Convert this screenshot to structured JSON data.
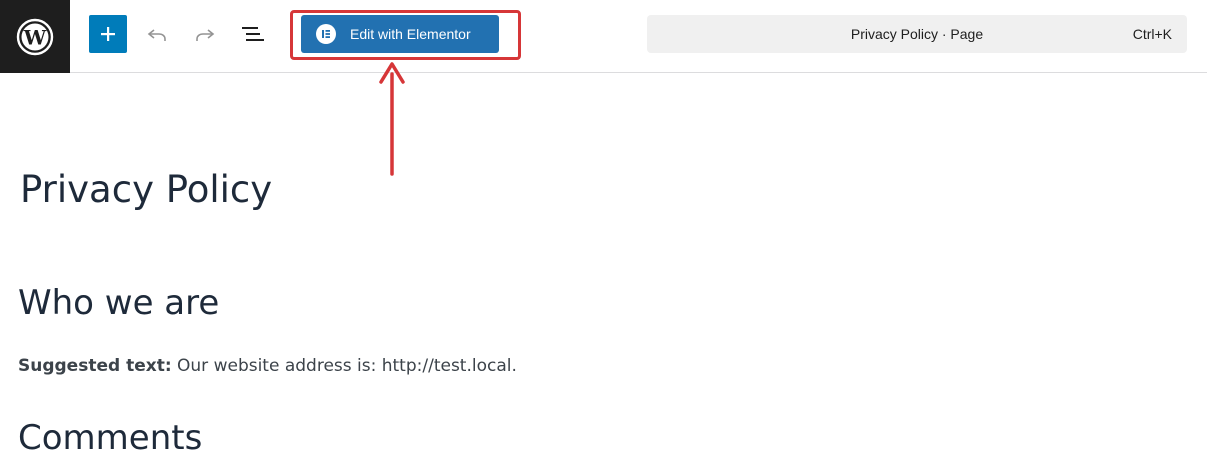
{
  "toolbar": {
    "logo_icon": "wordpress-logo-icon",
    "add_icon": "plus-icon",
    "undo_icon": "undo-icon",
    "redo_icon": "redo-icon",
    "outline_icon": "list-view-icon",
    "elementor_label": "Edit with Elementor",
    "elementor_icon": "elementor-logo-icon",
    "document_title": "Privacy Policy · Page",
    "shortcut": "Ctrl+K",
    "accent_color": "#007cba",
    "highlight_color": "#d63638"
  },
  "content": {
    "title": "Privacy Policy",
    "heading_who": "Who we are",
    "suggested_label": "Suggested text:",
    "suggested_body": " Our website address is: http://test.local.",
    "heading_comments": "Comments"
  }
}
